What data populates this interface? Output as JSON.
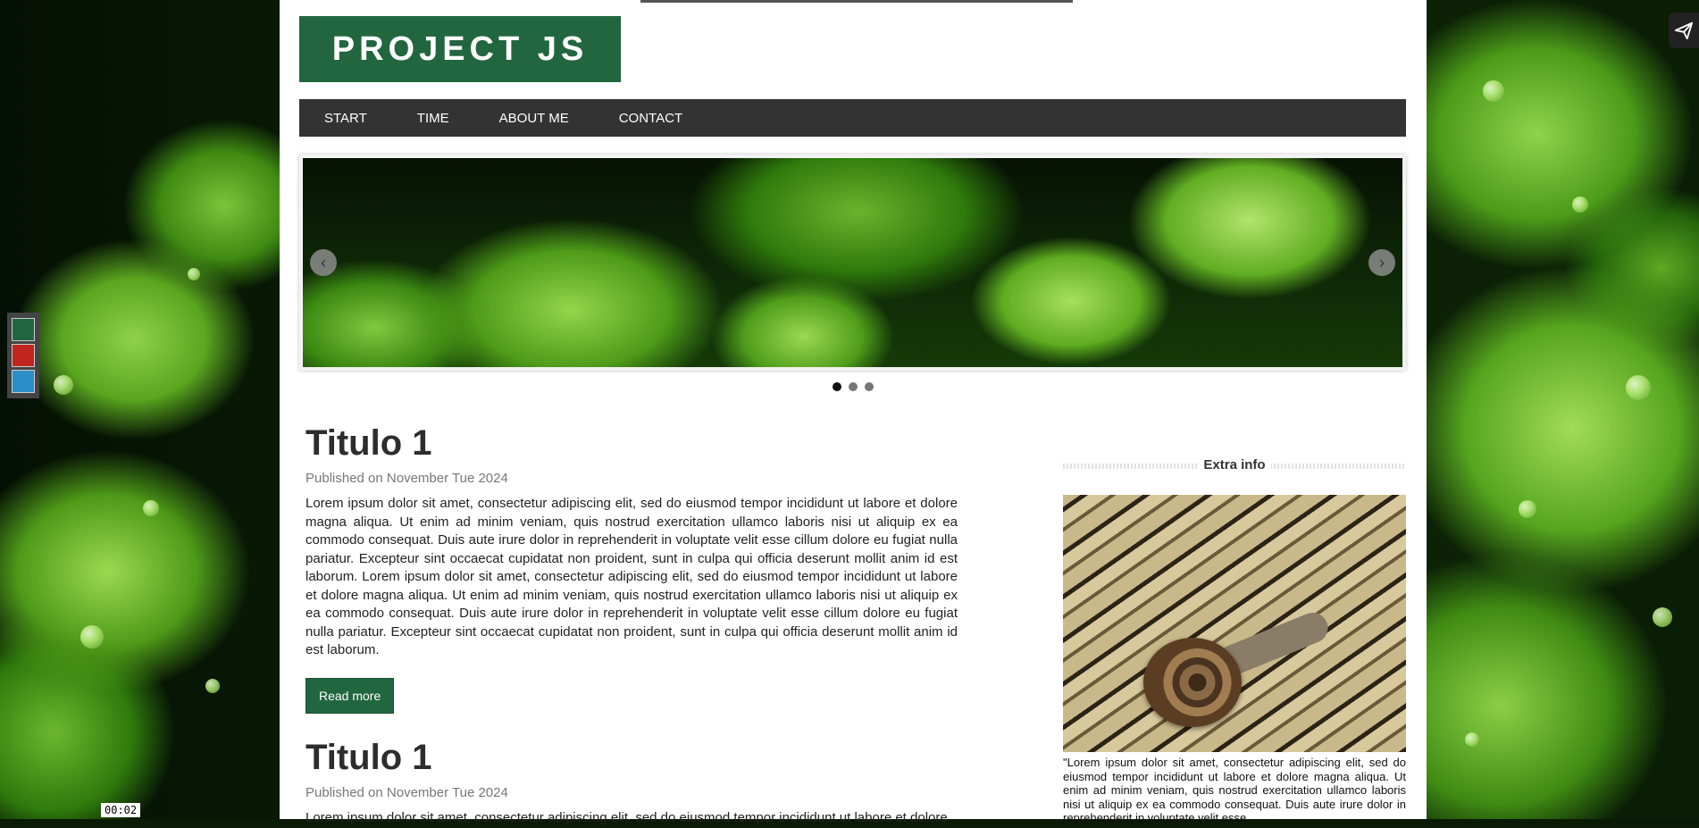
{
  "site": {
    "logo": "PROJECT JS"
  },
  "nav": {
    "items": [
      {
        "label": "START"
      },
      {
        "label": "TIME"
      },
      {
        "label": "ABOUT ME"
      },
      {
        "label": "CONTACT"
      }
    ]
  },
  "slider": {
    "prev_icon": "chevron-left-icon",
    "next_icon": "chevron-right-icon",
    "dot_count": 3,
    "active_dot": 1
  },
  "posts": [
    {
      "title": "Titulo 1",
      "meta": "Published on November Tue 2024",
      "body": "Lorem ipsum dolor sit amet, consectetur adipiscing elit, sed do eiusmod tempor incididunt ut labore et dolore magna aliqua. Ut enim ad minim veniam, quis nostrud exercitation ullamco laboris nisi ut aliquip ex ea commodo consequat. Duis aute irure dolor in reprehenderit in voluptate velit esse cillum dolore eu fugiat nulla pariatur. Excepteur sint occaecat cupidatat non proident, sunt in culpa qui officia deserunt mollit anim id est laborum. Lorem ipsum dolor sit amet, consectetur adipiscing elit, sed do eiusmod tempor incididunt ut labore et dolore magna aliqua. Ut enim ad minim veniam, quis nostrud exercitation ullamco laboris nisi ut aliquip ex ea commodo consequat. Duis aute irure dolor in reprehenderit in voluptate velit esse cillum dolore eu fugiat nulla pariatur. Excepteur sint occaecat cupidatat non proident, sunt in culpa qui officia deserunt mollit anim id est laborum.",
      "read_more": "Read more"
    },
    {
      "title": "Titulo 1",
      "meta": "Published on November Tue 2024",
      "body": "Lorem ipsum dolor sit amet, consectetur adipiscing elit, sed do eiusmod tempor incididunt ut labore et dolore"
    }
  ],
  "aside": {
    "title": "Extra info",
    "text": "\"Lorem ipsum dolor sit amet, consectetur adipiscing elit, sed do eiusmod tempor incididunt ut labore et dolore magna aliqua. Ut enim ad minim veniam, quis nostrud exercitation ullamco laboris nisi ut aliquip ex ea commodo consequat. Duis aute irure dolor in reprehenderit in voluptate velit esse"
  },
  "theme": {
    "swatches": [
      "#22663f",
      "#c0261e",
      "#2a8fc8"
    ],
    "accent": "#22663f",
    "nav_bg": "#333333"
  },
  "timer": "00:02",
  "share_icon": "share-icon"
}
